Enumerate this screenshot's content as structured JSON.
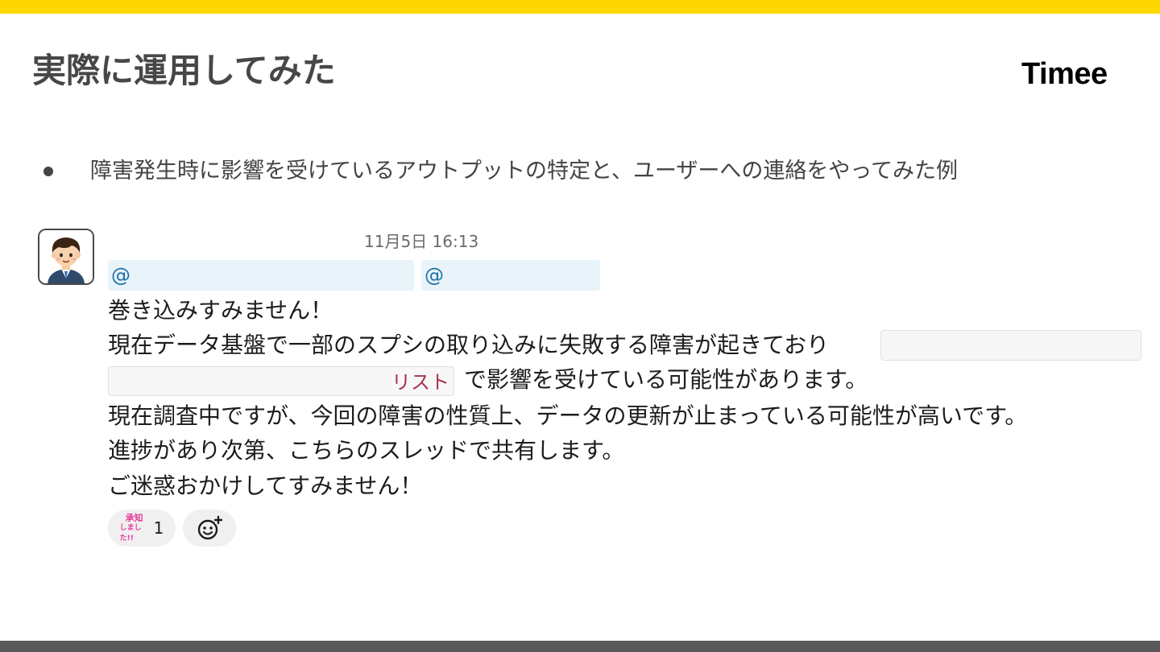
{
  "slide": {
    "title": "実際に運用してみた",
    "logo": "Timee",
    "bullet": "障害発生時に影響を受けているアウトプットの特定と、ユーザーへの連絡をやってみた例"
  },
  "message": {
    "timestamp": "11月5日 16:13",
    "mentions": [
      "@",
      "@"
    ],
    "lines": [
      "巻き込みすみません！",
      "現在データ基盤で一部のスプシの取り込みに失敗する障害が起きており",
      "で影響を受けている可能性があります。",
      "現在調査中ですが、今回の障害の性質上、データの更新が止まっている可能性が高いです。",
      "進捗があり次第、こちらのスレッドで共有します。",
      "ご迷惑おかけしてすみません！"
    ],
    "link_text": "リスト",
    "reactions": [
      {
        "stamp_line1": "承知",
        "stamp_line2": "しました!!",
        "count": "1"
      }
    ],
    "add_reaction_icon": "add-reaction-icon"
  },
  "colors": {
    "top_bar": "#ffd700",
    "bottom_bar": "#595959",
    "mention_bg": "#e8f4fa",
    "mention_text": "#1d6fa5",
    "link": "#a8334f",
    "stamp": "#e83a9a"
  }
}
